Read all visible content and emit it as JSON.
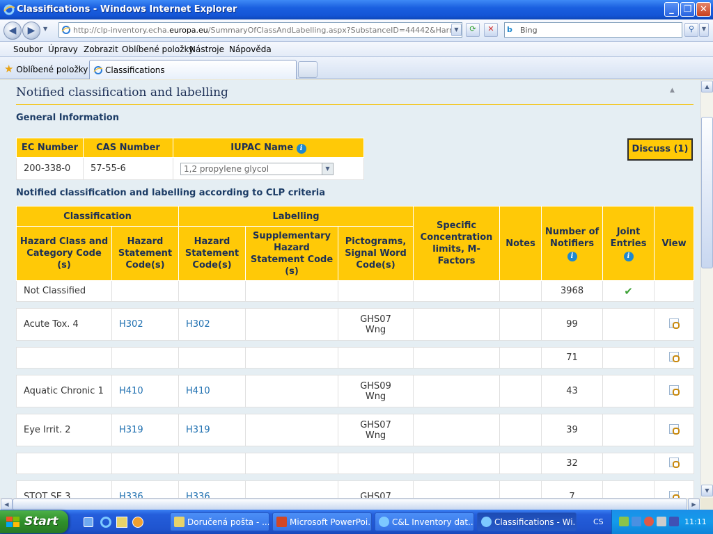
{
  "window": {
    "title": "Classifications - Windows Internet Explorer"
  },
  "address": {
    "url_prefix": "http://clp-inventory.echa.",
    "url_domain": "europa.eu",
    "url_suffix": "/SummaryOfClassAndLabelling.aspx?SubstanceID=44442&HarmOnly=no?f",
    "search_placeholder": "Bing"
  },
  "menu": [
    "Soubor",
    "Úpravy",
    "Zobrazit",
    "Oblíbené položky",
    "Nástroje",
    "Nápověda"
  ],
  "favorites": {
    "label": "Oblíbené položky",
    "tab_label": "Classifications"
  },
  "page": {
    "title": "Notified classification and labelling",
    "general_info_heading": "General Information",
    "gi_headers": {
      "ec": "EC Number",
      "cas": "CAS Number",
      "iupac": "IUPAC Name"
    },
    "gi_values": {
      "ec": "200-338-0",
      "cas": "57-55-6",
      "iupac": "1,2 propylene glycol"
    },
    "discuss_label": "Discuss (1)",
    "clp_heading": "Notified classification and labelling according to CLP criteria",
    "table_headers": {
      "classification": "Classification",
      "labelling": "Labelling",
      "hazard_class": "Hazard Class and Category Code (s)",
      "hazard_statement": "Hazard Statement Code(s)",
      "label_hazard_statement": "Hazard Statement Code(s)",
      "supplementary": "Supplementary Hazard Statement Code (s)",
      "pictograms": "Pictograms, Signal Word Code(s)",
      "specific": "Specific Concentration limits, M-Factors",
      "notes": "Notes",
      "notifiers": "Number of Notifiers",
      "joint": "Joint Entries",
      "view": "View"
    },
    "rows": [
      {
        "hazard_class": "Not Classified",
        "h_stmt": "",
        "l_stmt": "",
        "supp": "",
        "picto1": "",
        "picto2": "",
        "notifiers": "3968",
        "joint": "✔"
      },
      {
        "hazard_class": "Acute Tox. 4",
        "h_stmt": "H302",
        "l_stmt": "H302",
        "supp": "",
        "picto1": "GHS07",
        "picto2": "Wng",
        "notifiers": "99",
        "joint": ""
      },
      {
        "hazard_class": "",
        "h_stmt": "",
        "l_stmt": "",
        "supp": "",
        "picto1": "",
        "picto2": "",
        "notifiers": "71",
        "joint": ""
      },
      {
        "hazard_class": "Aquatic Chronic 1",
        "h_stmt": "H410",
        "l_stmt": "H410",
        "supp": "",
        "picto1": "GHS09",
        "picto2": "Wng",
        "notifiers": "43",
        "joint": ""
      },
      {
        "hazard_class": "Eye Irrit. 2",
        "h_stmt": "H319",
        "l_stmt": "H319",
        "supp": "",
        "picto1": "GHS07",
        "picto2": "Wng",
        "notifiers": "39",
        "joint": ""
      },
      {
        "hazard_class": "",
        "h_stmt": "",
        "l_stmt": "",
        "supp": "",
        "picto1": "",
        "picto2": "",
        "notifiers": "32",
        "joint": ""
      },
      {
        "hazard_class": "STOT SE 3",
        "h_stmt": "H336",
        "l_stmt": "H336",
        "supp": "",
        "picto1": "GHS07",
        "picto2": "",
        "notifiers": "7",
        "joint": ""
      }
    ]
  },
  "taskbar": {
    "start": "Start",
    "items": [
      "Doručená pošta - ...",
      "Microsoft PowerPoi...",
      "C&L Inventory dat...",
      "Classifications - Wi..."
    ],
    "lang": "CS",
    "clock": "11:11"
  }
}
